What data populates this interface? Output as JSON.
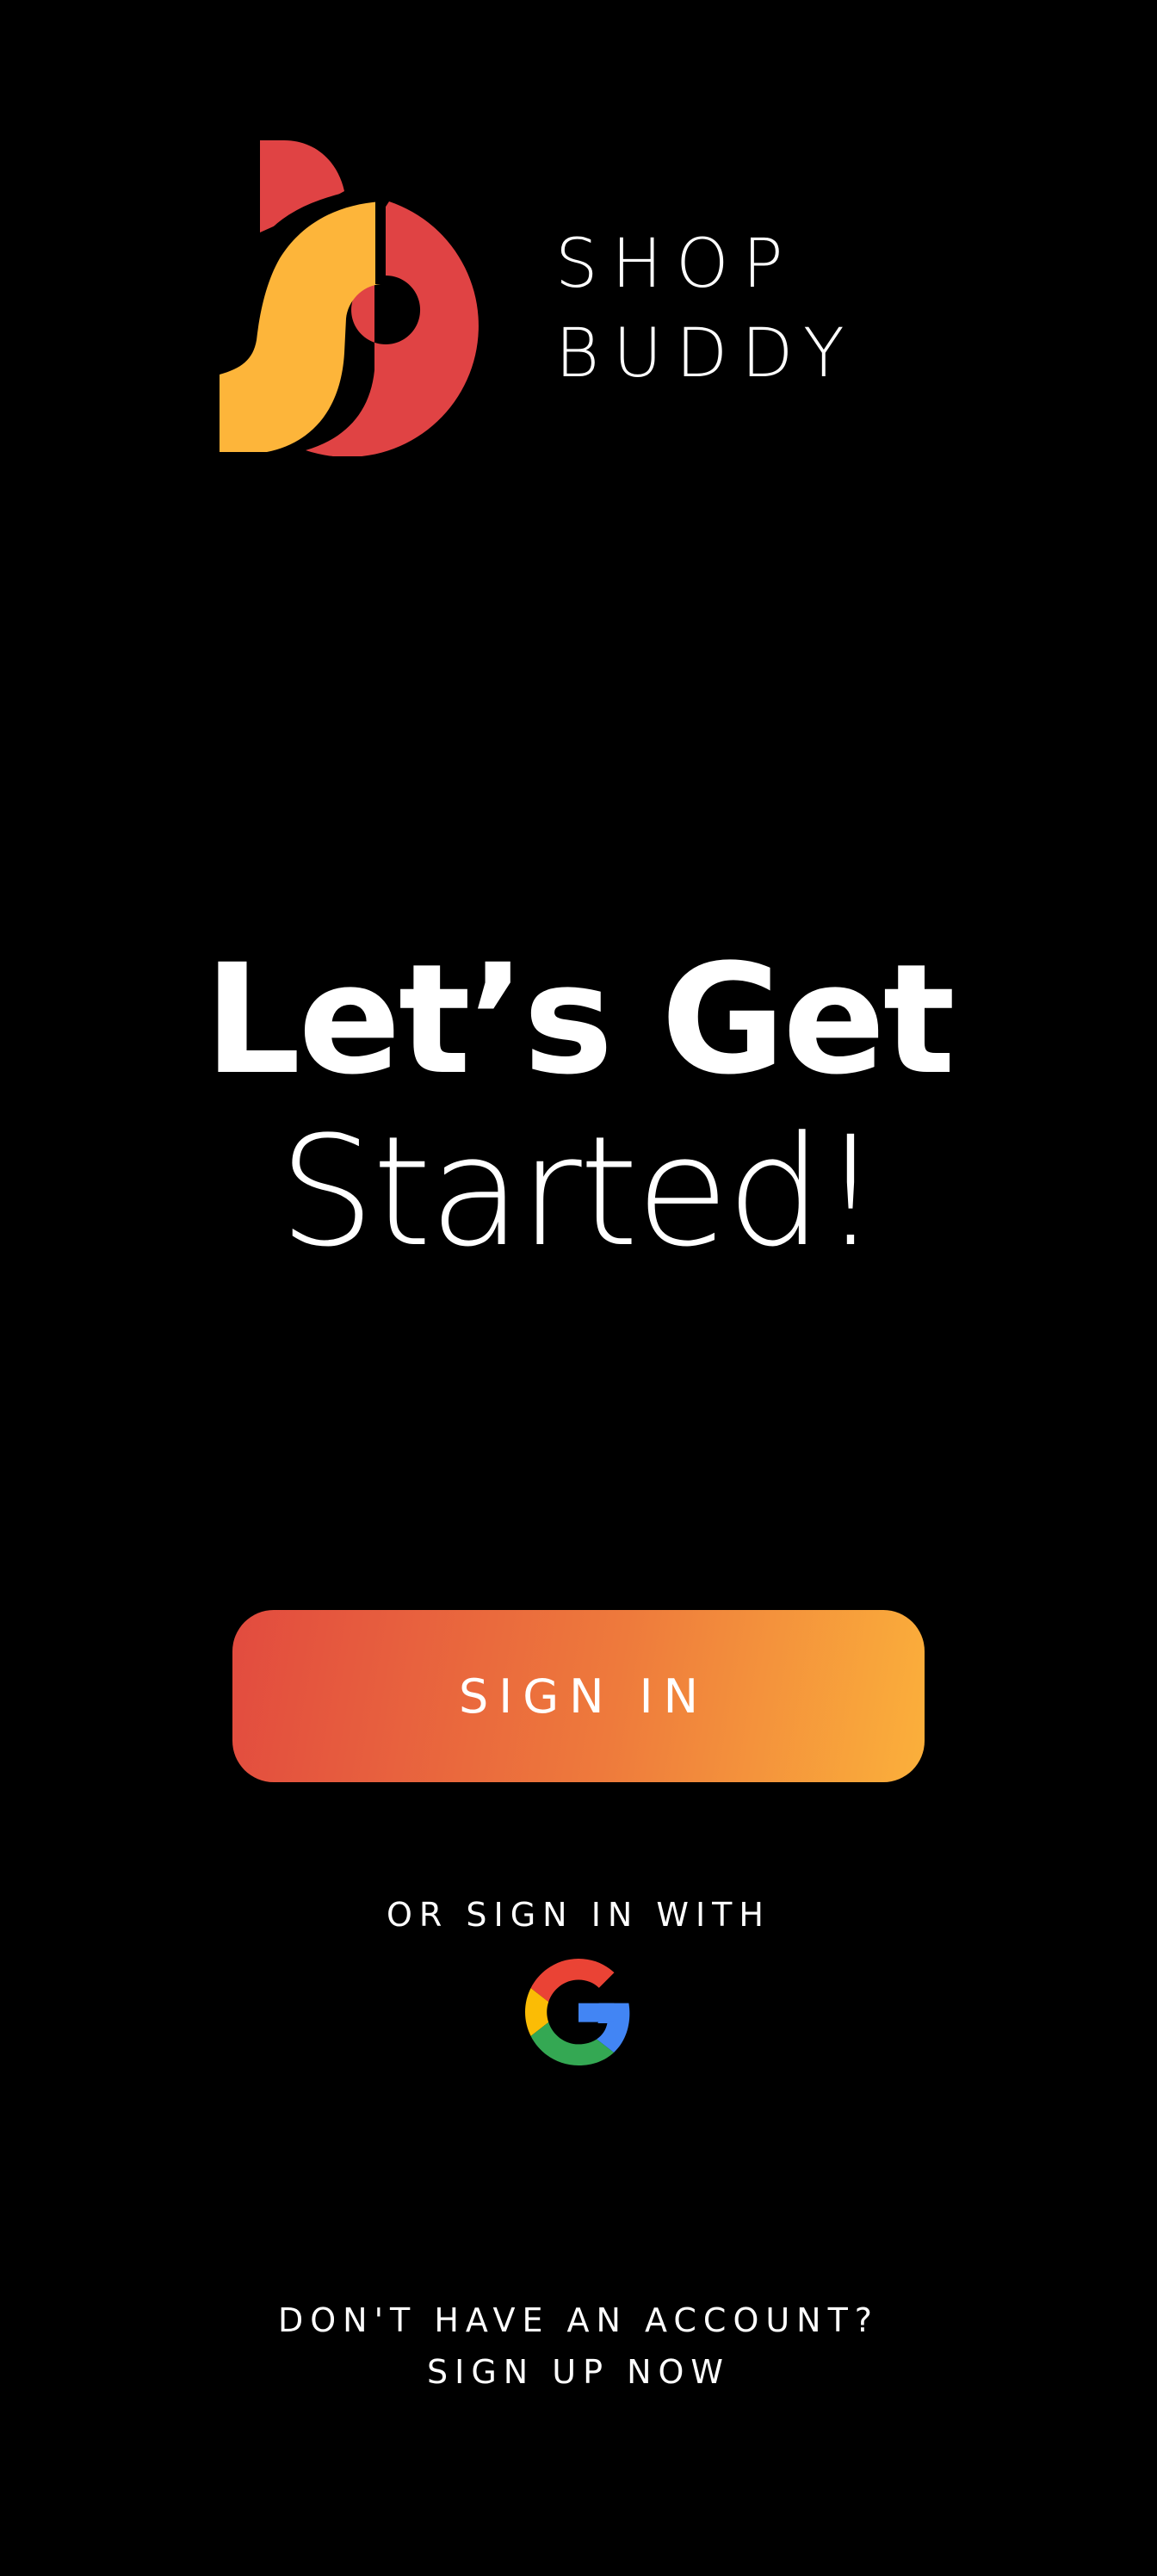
{
  "brand": {
    "line1": "SHOP",
    "line2": "BUDDY",
    "logo_icon": "shop-buddy-logo",
    "colors": {
      "red": "#E04344",
      "yellow": "#FDB53A"
    }
  },
  "headline": {
    "bold": "Let’s Get",
    "light": "Started!"
  },
  "signin_button": {
    "label": "SIGN IN",
    "gradient": [
      "#E24B3F",
      "#FBB03B"
    ]
  },
  "alternate": {
    "label": "OR SIGN IN WITH",
    "provider_icon": "google-icon"
  },
  "footer": {
    "prompt": "DON'T HAVE AN ACCOUNT?",
    "signup_link": "SIGN UP NOW"
  }
}
